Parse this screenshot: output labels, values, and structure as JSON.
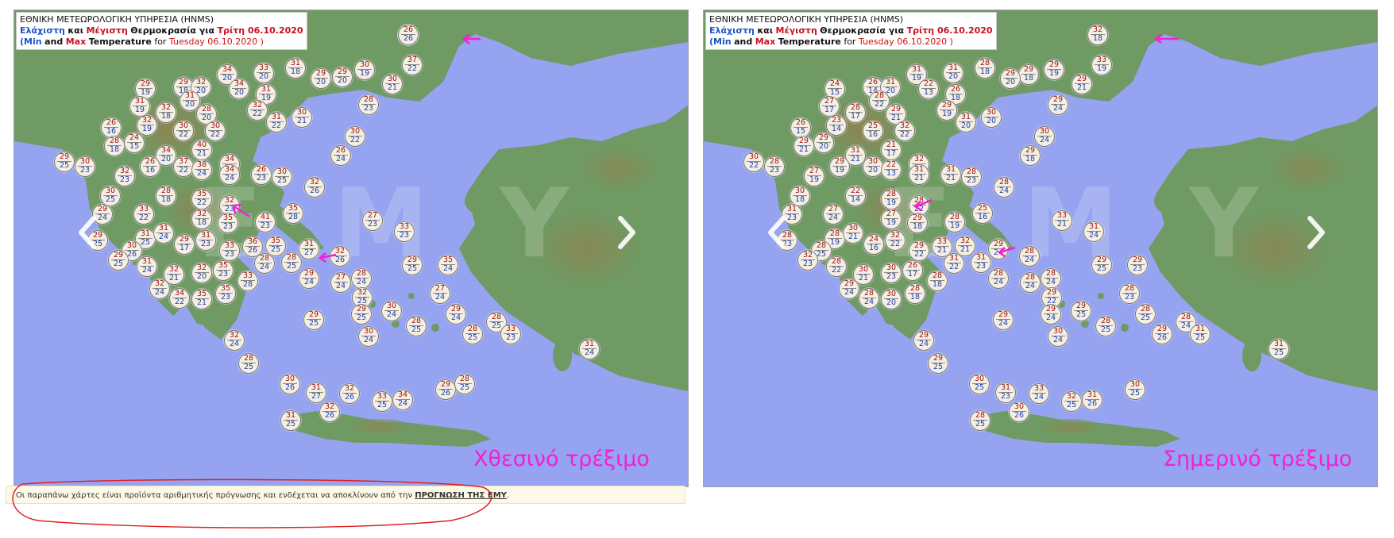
{
  "maps": [
    {
      "id": "yesterday",
      "header": {
        "line1": "ΕΘΝΙΚΗ ΜΕΤΕΩΡΟΛΟΓΙΚΗ ΥΠΗΡΕΣΙΑ (HNMS)",
        "min_gr": "Ελάχιστη",
        "and_gr": "και",
        "max_gr": "Μέγιστη",
        "temp_gr": "Θερμοκρασία για",
        "date_gr": "Τρίτη 06.10.2020",
        "open": "(",
        "min_en": "Min",
        "and_en": "and",
        "max_en": "Max",
        "temp_en": "Temperature",
        "for_en": "for",
        "date_en": "Tuesday 06.10.2020 )"
      },
      "run_label": "Χθεσινό τρέξιμο",
      "markers": [
        [
          "39",
          "19"
        ],
        [
          "37",
          "22"
        ],
        [
          "30",
          "21"
        ],
        [
          "30",
          "19"
        ],
        [
          "29",
          "20"
        ],
        [
          "29",
          "20"
        ],
        [
          "31",
          "18"
        ],
        [
          "33",
          "20"
        ],
        [
          "34",
          "20"
        ],
        [
          "34",
          "20"
        ],
        [
          "31",
          "19"
        ],
        [
          "32",
          "22"
        ],
        [
          "31",
          "22"
        ],
        [
          "30",
          "21"
        ],
        [
          "29",
          "19"
        ],
        [
          "31",
          "19"
        ],
        [
          "29",
          "18"
        ],
        [
          "32",
          "20"
        ],
        [
          "31",
          "20"
        ],
        [
          "28",
          "20"
        ],
        [
          "30",
          "22"
        ],
        [
          "26",
          "16"
        ],
        [
          "32",
          "19"
        ],
        [
          "32",
          "18"
        ],
        [
          "28",
          "18"
        ],
        [
          "24",
          "15"
        ],
        [
          "34",
          "20"
        ],
        [
          "30",
          "22"
        ],
        [
          "40",
          "21"
        ],
        [
          "34",
          "21"
        ],
        [
          "29",
          "25"
        ],
        [
          "30",
          "23"
        ],
        [
          "32",
          "23"
        ],
        [
          "26",
          "16"
        ],
        [
          "37",
          "22"
        ],
        [
          "38",
          "24"
        ],
        [
          "34",
          "24"
        ],
        [
          "26",
          "23"
        ],
        [
          "30",
          "25"
        ],
        [
          "32",
          "26"
        ],
        [
          "28",
          "23"
        ],
        [
          "30",
          "22"
        ],
        [
          "26",
          "24"
        ],
        [
          "30",
          "25"
        ],
        [
          "28",
          "18"
        ],
        [
          "35",
          "22"
        ],
        [
          "32",
          "23"
        ],
        [
          "29",
          "24"
        ],
        [
          "33",
          "22"
        ],
        [
          "32",
          "18"
        ],
        [
          "35",
          "23"
        ],
        [
          "35",
          "28"
        ],
        [
          "41",
          "23"
        ],
        [
          "27",
          "23"
        ],
        [
          "33",
          "23"
        ],
        [
          "29",
          "25"
        ],
        [
          "31",
          "25"
        ],
        [
          "31",
          "24"
        ],
        [
          "29",
          "17"
        ],
        [
          "31",
          "23"
        ],
        [
          "33",
          "23"
        ],
        [
          "36",
          "26"
        ],
        [
          "35",
          "25"
        ],
        [
          "31",
          "27"
        ],
        [
          "30",
          "26"
        ],
        [
          "29",
          "25"
        ],
        [
          "31",
          "24"
        ],
        [
          "32",
          "21"
        ],
        [
          "32",
          "20"
        ],
        [
          "35",
          "23"
        ],
        [
          "33",
          "28"
        ],
        [
          "28",
          "24"
        ],
        [
          "28",
          "25"
        ],
        [
          "32",
          "26"
        ],
        [
          "29",
          "24"
        ],
        [
          "28",
          "24"
        ],
        [
          "27",
          "24"
        ],
        [
          "32",
          "24"
        ],
        [
          "34",
          "22"
        ],
        [
          "35",
          "21"
        ],
        [
          "35",
          "23"
        ],
        [
          "32",
          "25"
        ],
        [
          "29",
          "25"
        ],
        [
          "30",
          "24"
        ],
        [
          "35",
          "24"
        ],
        [
          "27",
          "24"
        ],
        [
          "29",
          "25"
        ],
        [
          "29",
          "24"
        ],
        [
          "29",
          "25"
        ],
        [
          "30",
          "24"
        ],
        [
          "28",
          "25"
        ],
        [
          "28",
          "25"
        ],
        [
          "28",
          "25"
        ],
        [
          "33",
          "23"
        ],
        [
          "32",
          "24"
        ],
        [
          "28",
          "25"
        ],
        [
          "31",
          "24"
        ],
        [
          "30",
          "26"
        ],
        [
          "31",
          "27"
        ],
        [
          "32",
          "26"
        ],
        [
          "33",
          "25"
        ],
        [
          "34",
          "24"
        ],
        [
          "32",
          "26"
        ],
        [
          "31",
          "25"
        ],
        [
          "29",
          "26"
        ],
        [
          "28",
          "25"
        ],
        [
          "26",
          "26"
        ]
      ]
    },
    {
      "id": "today",
      "header": {
        "line1": "ΕΘΝΙΚΗ ΜΕΤΕΩΡΟΛΟΓΙΚΗ ΥΠΗΡΕΣΙΑ (HNMS)",
        "min_gr": "Ελάχιστη",
        "and_gr": "και",
        "max_gr": "Μέγιστη",
        "temp_gr": "Θερμοκρασία για",
        "date_gr": "Τρίτη 06.10.2020",
        "open": "(",
        "min_en": "Min",
        "and_en": "and",
        "max_en": "Max",
        "temp_en": "Temperature",
        "for_en": "for",
        "date_en": "Tuesday 06.10.2020 )"
      },
      "run_label": "Σημερινό τρέξιμο",
      "markers": [
        [
          "32",
          "18"
        ],
        [
          "33",
          "19"
        ],
        [
          "29",
          "21"
        ],
        [
          "29",
          "19"
        ],
        [
          "29",
          "18"
        ],
        [
          "29",
          "20"
        ],
        [
          "28",
          "18"
        ],
        [
          "31",
          "20"
        ],
        [
          "31",
          "19"
        ],
        [
          "22",
          "13"
        ],
        [
          "26",
          "18"
        ],
        [
          "29",
          "19"
        ],
        [
          "31",
          "20"
        ],
        [
          "30",
          "20"
        ],
        [
          "24",
          "15"
        ],
        [
          "27",
          "17"
        ],
        [
          "26",
          "14"
        ],
        [
          "31",
          "20"
        ],
        [
          "28",
          "22"
        ],
        [
          "29",
          "21"
        ],
        [
          "32",
          "22"
        ],
        [
          "26",
          "15"
        ],
        [
          "23",
          "14"
        ],
        [
          "28",
          "17"
        ],
        [
          "29",
          "21"
        ],
        [
          "29",
          "20"
        ],
        [
          "31",
          "21"
        ],
        [
          "25",
          "16"
        ],
        [
          "21",
          "17"
        ],
        [
          "32",
          "22"
        ],
        [
          "30",
          "22"
        ],
        [
          "28",
          "23"
        ],
        [
          "27",
          "19"
        ],
        [
          "29",
          "19"
        ],
        [
          "30",
          "20"
        ],
        [
          "22",
          "13"
        ],
        [
          "31",
          "21"
        ],
        [
          "31",
          "21"
        ],
        [
          "28",
          "23"
        ],
        [
          "28",
          "24"
        ],
        [
          "29",
          "24"
        ],
        [
          "30",
          "24"
        ],
        [
          "29",
          "18"
        ],
        [
          "30",
          "18"
        ],
        [
          "22",
          "14"
        ],
        [
          "28",
          "19"
        ],
        [
          "28",
          "22"
        ],
        [
          "31",
          "23"
        ],
        [
          "27",
          "24"
        ],
        [
          "27",
          "19"
        ],
        [
          "29",
          "18"
        ],
        [
          "25",
          "16"
        ],
        [
          "28",
          "19"
        ],
        [
          "33",
          "21"
        ],
        [
          "31",
          "24"
        ],
        [
          "28",
          "23"
        ],
        [
          "28",
          "19"
        ],
        [
          "30",
          "21"
        ],
        [
          "24",
          "16"
        ],
        [
          "32",
          "22"
        ],
        [
          "29",
          "22"
        ],
        [
          "33",
          "21"
        ],
        [
          "32",
          "21"
        ],
        [
          "29",
          "24"
        ],
        [
          "28",
          "25"
        ],
        [
          "32",
          "23"
        ],
        [
          "28",
          "22"
        ],
        [
          "30",
          "21"
        ],
        [
          "30",
          "23"
        ],
        [
          "26",
          "17"
        ],
        [
          "28",
          "18"
        ],
        [
          "31",
          "22"
        ],
        [
          "31",
          "23"
        ],
        [
          "28",
          "24"
        ],
        [
          "28",
          "24"
        ],
        [
          "28",
          "24"
        ],
        [
          "28",
          "24"
        ],
        [
          "29",
          "24"
        ],
        [
          "28",
          "24"
        ],
        [
          "30",
          "20"
        ],
        [
          "28",
          "18"
        ],
        [
          "29",
          "22"
        ],
        [
          "29",
          "24"
        ],
        [
          "29",
          "25"
        ],
        [
          "29",
          "23"
        ],
        [
          "28",
          "23"
        ],
        [
          "29",
          "25"
        ],
        [
          "28",
          "25"
        ],
        [
          "29",
          "24"
        ],
        [
          "30",
          "24"
        ],
        [
          "28",
          "25"
        ],
        [
          "29",
          "26"
        ],
        [
          "28",
          "24"
        ],
        [
          "31",
          "25"
        ],
        [
          "29",
          "24"
        ],
        [
          "29",
          "25"
        ],
        [
          "31",
          "25"
        ],
        [
          "30",
          "25"
        ],
        [
          "31",
          "23"
        ],
        [
          "33",
          "24"
        ],
        [
          "32",
          "25"
        ],
        [
          "31",
          "26"
        ],
        [
          "30",
          "26"
        ],
        [
          "28",
          "25"
        ],
        [
          "30",
          "25"
        ]
      ]
    }
  ],
  "disclaimer": {
    "text": "Οι παραπάνω χάρτες είναι προϊόντα αριθμητικής πρόγνωσης και ενδέχεται να αποκλίνουν από την ",
    "link": "ΠΡΟΓΝΩΣΗ ΤΗΣ ΕΜΥ",
    "end": "."
  },
  "watermark": "ΕΜΥ",
  "colors": {
    "sea": "#95a3f0",
    "land": "#6f9a63",
    "accent_magenta": "#f51fd4",
    "max_red": "#9a1010",
    "min_blue": "#1d3fae"
  }
}
